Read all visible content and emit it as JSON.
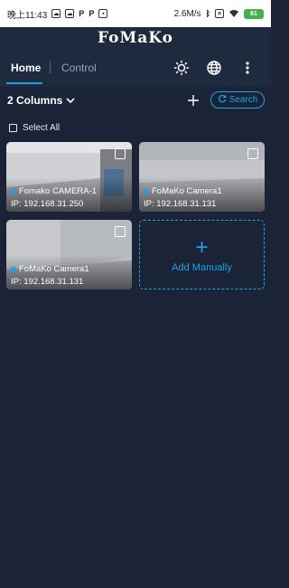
{
  "status_bar": {
    "time": "晚上11:43",
    "speed": "2.6M/s",
    "battery": "61"
  },
  "app": {
    "brand": "FoMaKo"
  },
  "tabs": [
    {
      "label": "Home",
      "active": true
    },
    {
      "label": "Control",
      "active": false
    }
  ],
  "toolbar": {
    "columns_label": "2 Columns",
    "search_label": "Search",
    "select_all_label": "Select All"
  },
  "cameras": [
    {
      "name": "Fomako CAMERA-1",
      "ip": "IP: 192.168.31.250"
    },
    {
      "name": "FoMaKo Camera1",
      "ip": "IP: 192.168.31.131"
    },
    {
      "name": "FoMaKo Camera1",
      "ip": "IP: 192.168.31.131"
    }
  ],
  "add_manually": {
    "icon": "+",
    "label": "Add Manually"
  },
  "colors": {
    "background": "#1b2437",
    "app_bar": "#1e2a3e",
    "accent": "#1aa3e8",
    "inactive_tab": "#9aa4b5"
  }
}
